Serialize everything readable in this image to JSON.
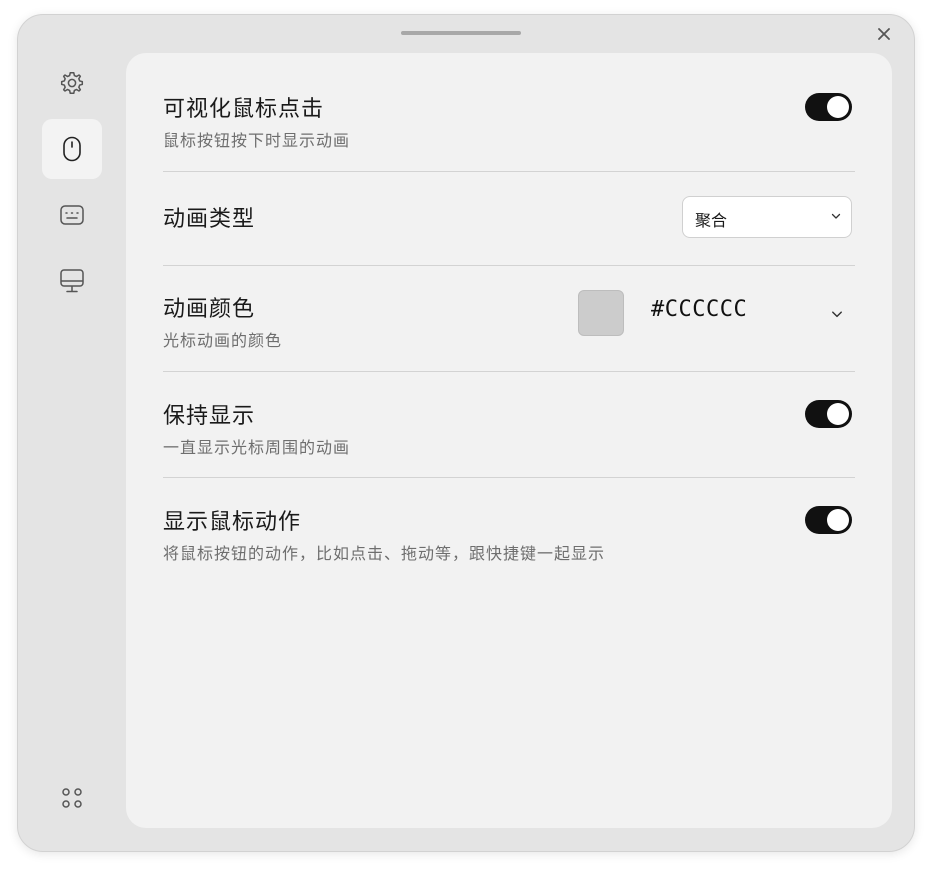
{
  "sidebar": {
    "items": [
      {
        "name": "settings",
        "icon": "gear-icon",
        "active": false
      },
      {
        "name": "mouse",
        "icon": "mouse-icon",
        "active": true
      },
      {
        "name": "keyboard",
        "icon": "keyboard-icon",
        "active": false
      },
      {
        "name": "display",
        "icon": "monitor-icon",
        "active": false
      }
    ],
    "bottom_icon": "apps-grid-icon"
  },
  "settings": {
    "visualize_clicks": {
      "title": "可视化鼠标点击",
      "description": "鼠标按钮按下时显示动画",
      "enabled": true
    },
    "animation_type": {
      "title": "动画类型",
      "selected": "聚合"
    },
    "animation_color": {
      "title": "动画颜色",
      "description": "光标动画的颜色",
      "hex": "#CCCCCC",
      "swatch_color": "#cccccc"
    },
    "keep_showing": {
      "title": "保持显示",
      "description": "一直显示光标周围的动画",
      "enabled": true
    },
    "show_mouse_actions": {
      "title": "显示鼠标动作",
      "description": "将鼠标按钮的动作，比如点击、拖动等，跟快捷键一起显示",
      "enabled": true
    }
  },
  "colors": {
    "toggle_on": "#111111",
    "window_bg": "#e4e4e4",
    "content_bg": "#f2f2f2"
  }
}
